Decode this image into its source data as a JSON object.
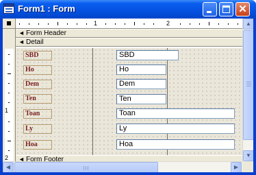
{
  "window": {
    "title": "Form1 : Form",
    "minimize_glyph": "minimize",
    "maximize_glyph": "maximize",
    "close_glyph": "✕"
  },
  "ruler": {
    "horizontal_labels": [
      "1",
      "2"
    ],
    "vertical_labels": [
      "1",
      "2"
    ]
  },
  "sections": {
    "form_header": "Form Header",
    "detail": "Detail",
    "form_footer": "Form Footer"
  },
  "fields": [
    {
      "label": "SBD",
      "textbox": "SBD"
    },
    {
      "label": "Ho",
      "textbox": "Ho"
    },
    {
      "label": "Dem",
      "textbox": "Dem"
    },
    {
      "label": "Ten",
      "textbox": "Ten"
    },
    {
      "label": "Toan",
      "textbox": "Toan"
    },
    {
      "label": "Ly",
      "textbox": "Ly"
    },
    {
      "label": "Hoa",
      "textbox": "Hoa"
    }
  ],
  "scrollbar": {
    "up_arrow": "▲",
    "down_arrow": "▼",
    "left_arrow": "◀",
    "right_arrow": "▶"
  },
  "colors": {
    "titlebar": "#0551e0",
    "label_text": "#7a1e1e",
    "grid_background": "#eae6da"
  }
}
